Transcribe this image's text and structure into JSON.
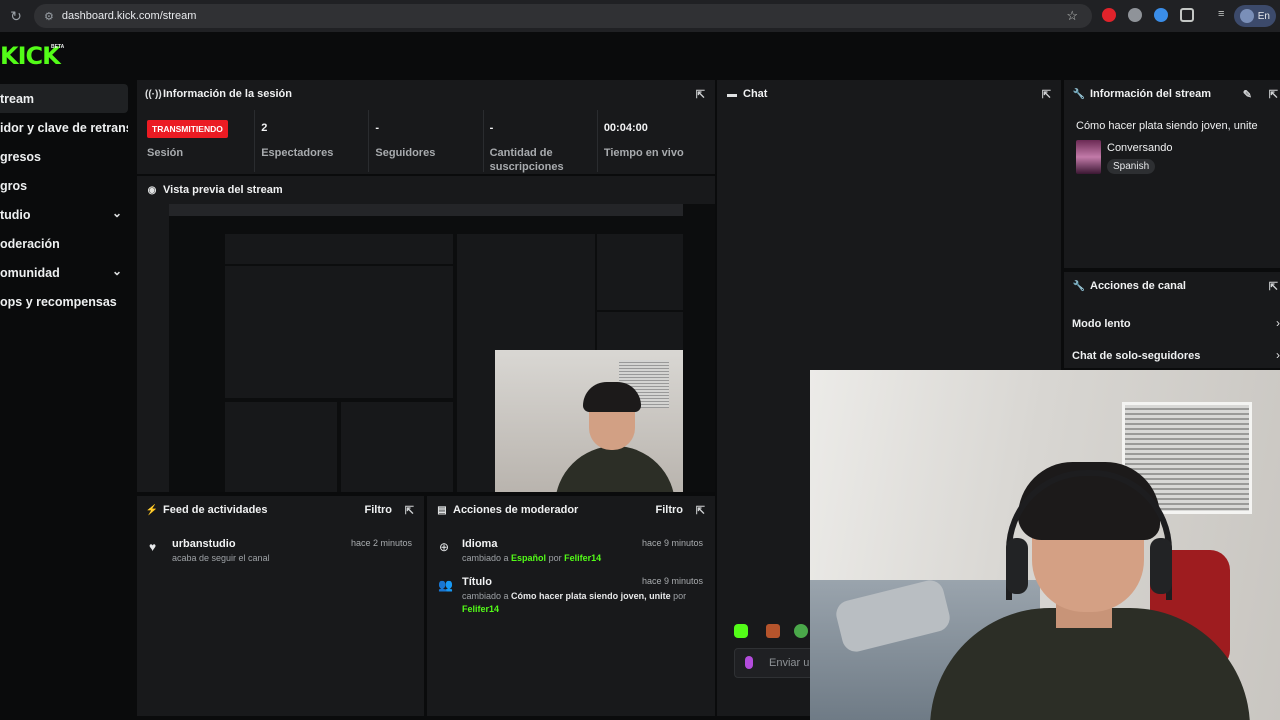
{
  "browser": {
    "url": "dashboard.kick.com/stream",
    "profile_label": "En"
  },
  "brand": {
    "logo": "KICK",
    "beta": "BETA",
    "accent": "#53fc18"
  },
  "sidebar": {
    "items": [
      {
        "label": "tream",
        "active": true
      },
      {
        "label": "idor y clave de retransm"
      },
      {
        "label": "gresos"
      },
      {
        "label": "gros"
      },
      {
        "label": "tudio",
        "expandable": true
      },
      {
        "label": "oderación"
      },
      {
        "label": "omunidad",
        "expandable": true
      },
      {
        "label": "ops y recompensas"
      }
    ]
  },
  "session": {
    "title": "Información de la sesión",
    "live_badge": "TRANSMITIENDO",
    "session_label": "Sesión",
    "stats": [
      {
        "value": "2",
        "label": "Espectadores"
      },
      {
        "value": "-",
        "label": "Seguidores"
      },
      {
        "value": "-",
        "label": "Cantidad de suscripciones"
      },
      {
        "value": "00:04:00",
        "label": "Tiempo en vivo"
      }
    ]
  },
  "preview": {
    "title": "Vista previa del stream"
  },
  "chat": {
    "title": "Chat",
    "input_placeholder": "Enviar ur"
  },
  "stream_info": {
    "title": "Información del stream",
    "stream_title": "Cómo hacer plata siendo joven, unite",
    "category": "Conversando",
    "language": "Spanish"
  },
  "channel_actions": {
    "title": "Acciones de canal",
    "items": [
      "Modo lento",
      "Chat de solo-seguidores"
    ]
  },
  "activity_feed": {
    "title": "Feed de actividades",
    "filter": "Filtro",
    "items": [
      {
        "user": "urbanstudio",
        "desc": "acaba de seguir el canal",
        "time": "hace 2 minutos"
      }
    ]
  },
  "mod_actions": {
    "title": "Acciones de moderador",
    "filter": "Filtro",
    "items": [
      {
        "title": "Idioma",
        "prefix": "cambiado a",
        "value": "Español",
        "by": "por",
        "user": "Felifer14",
        "time": "hace 9 minutos"
      },
      {
        "title": "Título",
        "prefix": "cambiado a",
        "value": "Cómo hacer plata siendo joven, unite",
        "by": "por",
        "user": "Felifer14",
        "time": "hace 9 minutos"
      }
    ]
  }
}
